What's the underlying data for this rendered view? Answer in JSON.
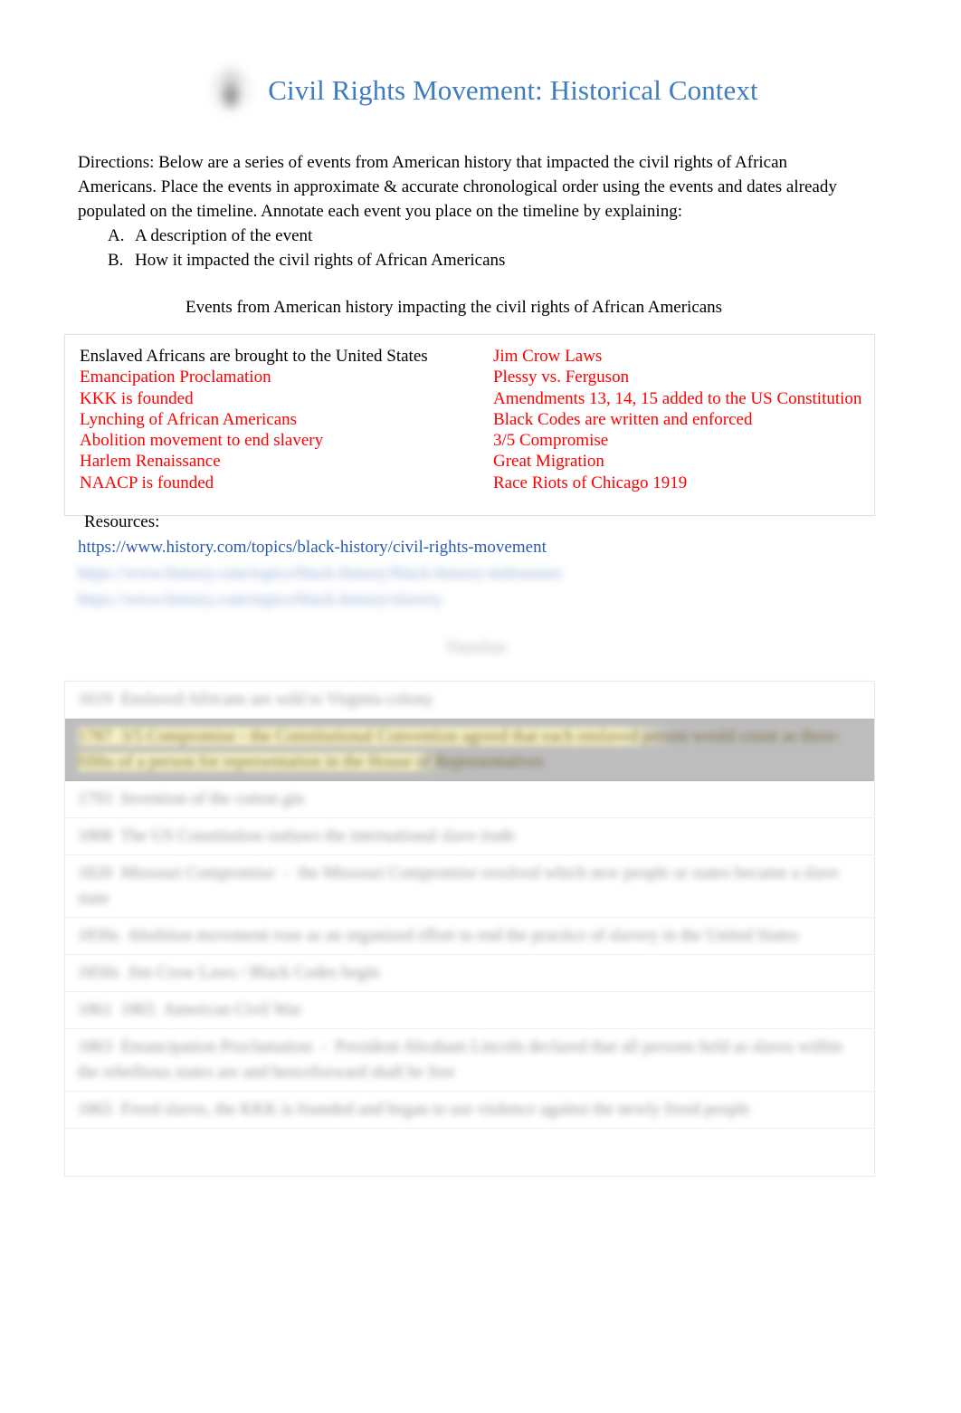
{
  "document": {
    "title": "Civil Rights Movement: Historical Context",
    "avatar_icon": "profile-avatar-image"
  },
  "directions": {
    "line1": "Directions:  Below are a series of events from American history that impacted the civil rights of African",
    "line2": "Americans. Place the events in approximate & accurate chronological order using the events and dates already",
    "line3": "populated on the timeline.    Annotate each event you place on the timeline by explaining:",
    "items": [
      {
        "marker": "A.",
        "text": "A description of the event"
      },
      {
        "marker": "B.",
        "text": "How it impacted the civil rights of African Americans"
      }
    ]
  },
  "events_section": {
    "heading": "Events from American history impacting the civil rights of African Americans",
    "left_column": [
      {
        "text": "Enslaved Africans are brought to the United States",
        "color": "#000000"
      },
      {
        "text": "Emancipation Proclamation",
        "color": "#FF0000"
      },
      {
        "text": "KKK is founded",
        "color": "#FF0000"
      },
      {
        "text": "Lynching of African Americans",
        "color": "#FF0000"
      },
      {
        "text": "Abolition movement to end slavery",
        "color": "#FF0000"
      },
      {
        "text": "Harlem Renaissance",
        "color": "#FF0000"
      },
      {
        "text": "NAACP is founded",
        "color": "#FF0000"
      }
    ],
    "right_column": [
      {
        "text": "Jim Crow Laws",
        "color": "#FF0000"
      },
      {
        "text": "Plessy vs. Ferguson",
        "color": "#FF0000"
      },
      {
        "text": "Amendments 13, 14, 15 added to the US Constitution",
        "color": "#FF0000"
      },
      {
        "text": "Black Codes are written and enforced",
        "color": "#FF0000"
      },
      {
        "text": "3/5 Compromise",
        "color": "#FF0000"
      },
      {
        "text": "Great Migration",
        "color": "#FF0000"
      },
      {
        "text": "Race Riots of Chicago 1919",
        "color": "#FF0000"
      }
    ]
  },
  "resources": {
    "label": "Resources:",
    "links": [
      "https://www.history.com/topics/black-history/civil-rights-movement",
      "https://www.history.com/topics/black-history/black-history-milestones",
      "https://www.history.com/topics/black-history/slavery"
    ]
  },
  "timeline": {
    "title": "Timeline",
    "rows": [
      {
        "text": "1619  Enslaved Africans are sold to Virginia colony",
        "selected": false
      },
      {
        "text": "1787  3/5 Compromise - the Constitutional Convention agreed that each enslaved person would count as three-fifths of a person for representation in the House of Representatives",
        "selected": true
      },
      {
        "text": "1793  Invention of the cotton gin",
        "selected": false
      },
      {
        "text": "1808  The US Constitution outlaws the international slave trade",
        "selected": false
      },
      {
        "text": "1820  Missouri Compromise  -  the Missouri Compromise resolved which new people or states became a slave state",
        "selected": false
      },
      {
        "text": "1830s  Abolition movement rose as an organized effort to end the practice of slavery in the United States",
        "selected": false
      },
      {
        "text": "1850s  Jim Crow Laws / Black Codes begin",
        "selected": false
      },
      {
        "text": "1861  1865  American Civil War",
        "selected": false
      },
      {
        "text": "1863  Emancipation Proclamation  -  President Abraham Lincoln declared that all persons held as slaves within the rebellious states are and henceforward shall be free",
        "selected": false
      },
      {
        "text": "1865  Freed slaves, the KKK is founded and began to use violence against the newly freed people",
        "selected": false
      }
    ]
  }
}
